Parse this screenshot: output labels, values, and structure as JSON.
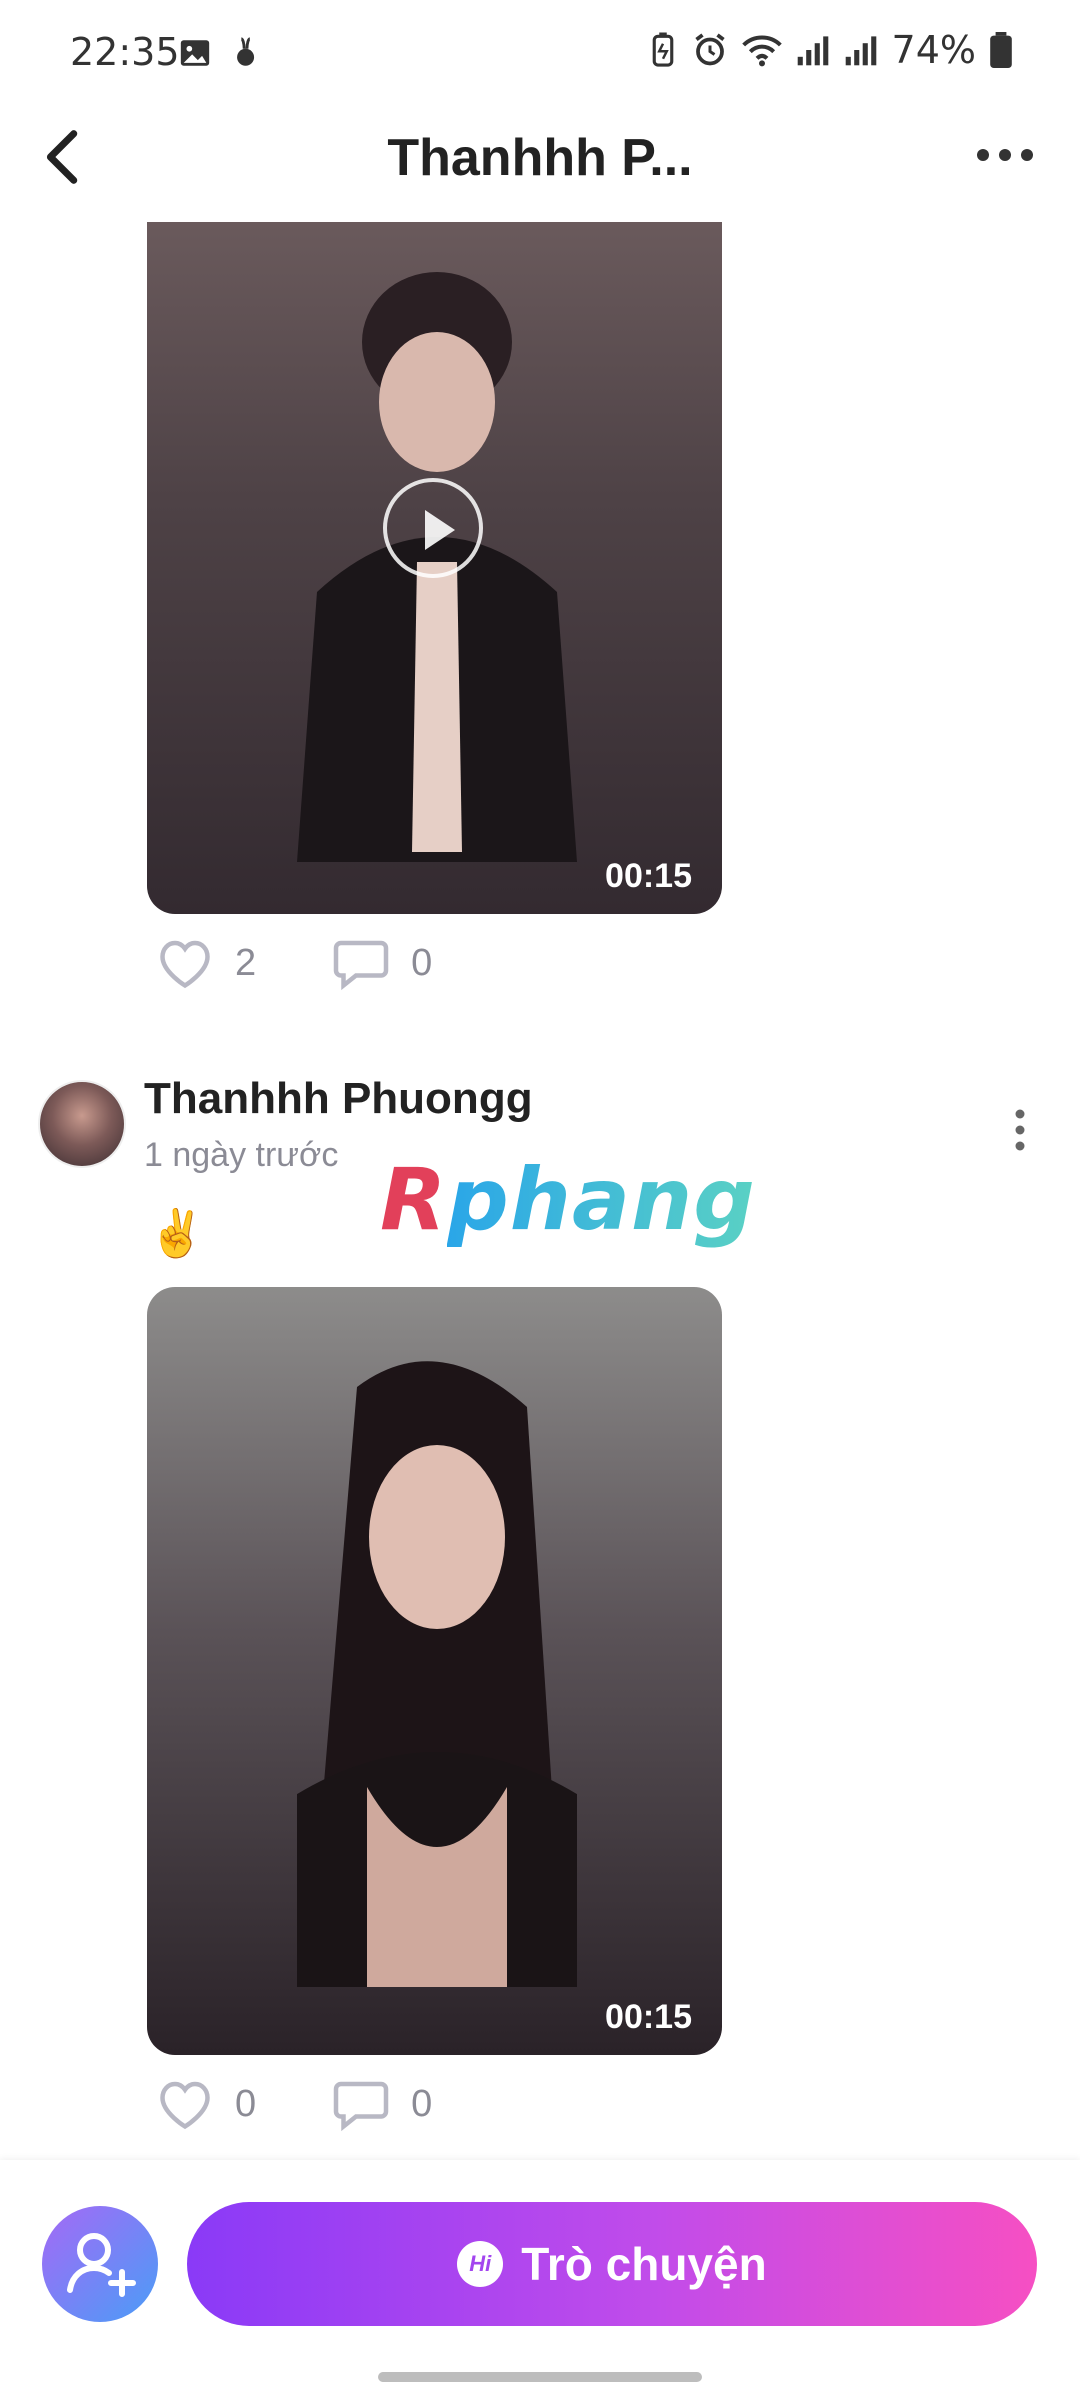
{
  "status_bar": {
    "time": "22:35",
    "battery": "74%",
    "icons": [
      "image-icon",
      "bunny-icon",
      "battery-saver-icon",
      "alarm-icon",
      "wifi-icon",
      "signal-icon",
      "signal-icon",
      "battery-icon"
    ]
  },
  "header": {
    "title": "Thanhhh P..."
  },
  "posts": [
    {
      "duration": "00:15",
      "likes": "2",
      "comments": "0"
    },
    {
      "author": "Thanhhh Phuongg",
      "time_ago": "1 ngày trước",
      "caption": "✌️",
      "duration": "00:15",
      "likes": "0",
      "comments": "0"
    }
  ],
  "watermark": {
    "part1": "R",
    "part2": "phang"
  },
  "bottom": {
    "chat_label": "Trò chuyện",
    "hi_badge": "Hi"
  },
  "colors": {
    "accent_start": "#8a3af7",
    "accent_end": "#f64fc3"
  }
}
